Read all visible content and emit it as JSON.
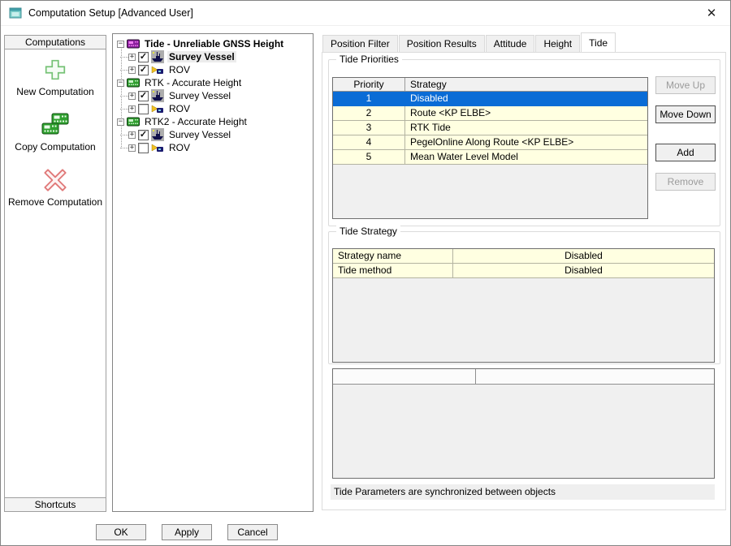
{
  "icons": {
    "minus": "−",
    "plus": "+",
    "check": "✓",
    "close": "✕"
  },
  "window": {
    "title": "Computation Setup [Advanced User]"
  },
  "sidebar": {
    "top_header": "Computations",
    "actions": [
      {
        "label": "New Computation",
        "icon": "new-computation-icon"
      },
      {
        "label": "Copy Computation",
        "icon": "copy-computation-icon"
      },
      {
        "label": "Remove Computation",
        "icon": "remove-computation-icon"
      }
    ],
    "bottom_header": "Shortcuts"
  },
  "tree": {
    "computations": [
      {
        "label": "Tide - Unreliable GNSS Height",
        "icon": "calculator-purple",
        "expanded": true,
        "children": [
          {
            "label": "Survey Vessel",
            "checked": true,
            "selected": true,
            "icon": "survey-vessel"
          },
          {
            "label": "ROV",
            "checked": true,
            "icon": "rov"
          }
        ]
      },
      {
        "label": "RTK - Accurate Height",
        "icon": "calculator-green",
        "expanded": true,
        "children": [
          {
            "label": "Survey Vessel",
            "checked": true,
            "icon": "survey-vessel"
          },
          {
            "label": "ROV",
            "checked": false,
            "icon": "rov"
          }
        ]
      },
      {
        "label": "RTK2 - Accurate Height",
        "icon": "calculator-green",
        "expanded": true,
        "children": [
          {
            "label": "Survey Vessel",
            "checked": true,
            "icon": "survey-vessel"
          },
          {
            "label": "ROV",
            "checked": false,
            "icon": "rov"
          }
        ]
      }
    ]
  },
  "tabs": {
    "items": [
      {
        "label": "Position Filter",
        "active": false
      },
      {
        "label": "Position Results",
        "active": false
      },
      {
        "label": "Attitude",
        "active": false
      },
      {
        "label": "Height",
        "active": false
      },
      {
        "label": "Tide",
        "active": true
      }
    ]
  },
  "tide_priorities": {
    "title": "Tide Priorities",
    "columns": {
      "priority": "Priority",
      "strategy": "Strategy"
    },
    "rows": [
      {
        "priority": "1",
        "strategy": "Disabled",
        "selected": true
      },
      {
        "priority": "2",
        "strategy": "Route <KP ELBE>",
        "selected": false
      },
      {
        "priority": "3",
        "strategy": "RTK Tide",
        "selected": false
      },
      {
        "priority": "4",
        "strategy": "PegelOnline Along Route <KP ELBE>",
        "selected": false
      },
      {
        "priority": "5",
        "strategy": "Mean Water Level Model",
        "selected": false
      }
    ],
    "buttons": [
      {
        "label": "Move Up",
        "enabled": false
      },
      {
        "label": "Move Down",
        "enabled": true
      },
      {
        "label": "Add",
        "enabled": true
      },
      {
        "label": "Remove",
        "enabled": false
      }
    ]
  },
  "tide_strategy": {
    "title": "Tide Strategy",
    "rows": [
      {
        "name": "Strategy name",
        "value": "Disabled"
      },
      {
        "name": "Tide method",
        "value": "Disabled"
      }
    ]
  },
  "empty_table": {
    "columns": [
      "",
      ""
    ]
  },
  "status_text": "Tide Parameters are synchronized between objects",
  "footer": {
    "buttons": [
      {
        "label": "OK"
      },
      {
        "label": "Apply"
      },
      {
        "label": "Cancel"
      }
    ]
  },
  "colors": {
    "selection_blue": "#0a6cd6",
    "cell_yellow": "#ffffe1",
    "computation_green": "#2fa12f",
    "computation_purple": "#8b1f9e",
    "remove_red": "#e07878",
    "new_green": "#76c276"
  }
}
